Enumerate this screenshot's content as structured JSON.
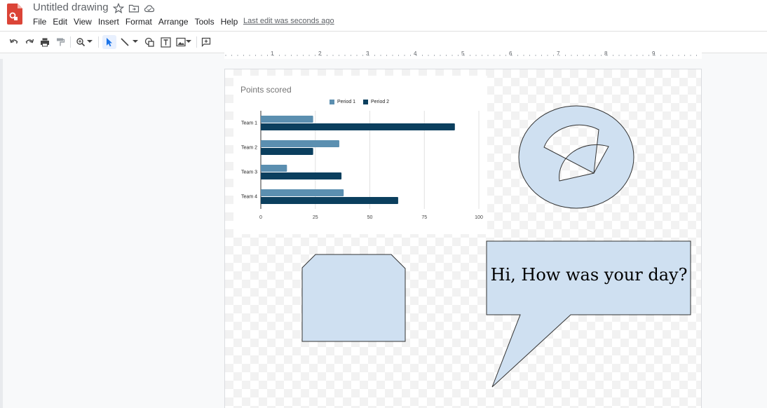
{
  "app": {
    "title": "Untitled drawing",
    "menu": [
      "File",
      "Edit",
      "View",
      "Insert",
      "Format",
      "Arrange",
      "Tools",
      "Help"
    ],
    "last_edit": "Last edit was seconds ago"
  },
  "toolbar": {
    "icons": [
      "undo-icon",
      "redo-icon",
      "print-icon",
      "paint-format-icon",
      "zoom-icon",
      "select-icon",
      "line-icon",
      "shape-icon",
      "textbox-icon",
      "image-icon",
      "comment-icon"
    ]
  },
  "ruler": {
    "labels": [
      "1",
      "2",
      "3",
      "4",
      "5",
      "6",
      "7",
      "8",
      "9"
    ]
  },
  "chart_data": {
    "type": "bar",
    "orientation": "horizontal",
    "title": "Points scored",
    "categories": [
      "Team 1",
      "Team 2",
      "Team 3",
      "Team 4"
    ],
    "series": [
      {
        "name": "Period 1",
        "values": [
          24,
          36,
          12,
          38
        ],
        "color": "#5b8fb0"
      },
      {
        "name": "Period 2",
        "values": [
          89,
          24,
          37,
          63
        ],
        "color": "#0b3f5e"
      }
    ],
    "xticks": [
      "0",
      "25",
      "50",
      "75",
      "100"
    ],
    "xlim": [
      0,
      100
    ],
    "grid": true,
    "legend": "top"
  },
  "shapes": {
    "prohibition_fill": "#cfe0f1",
    "bubble_text": "Hi, How was your day?"
  },
  "colors": {
    "accent": "#1a73e8",
    "shape_fill": "#cfe0f1"
  }
}
